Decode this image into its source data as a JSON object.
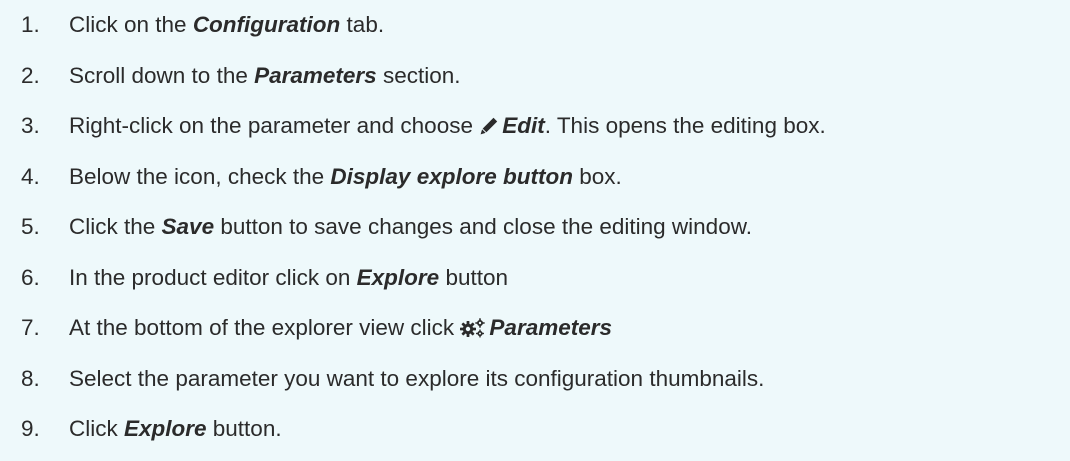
{
  "steps": [
    {
      "number": "1.",
      "parts": [
        {
          "t": "Click on the "
        },
        {
          "t": "Configuration",
          "em": true
        },
        {
          "t": " tab."
        }
      ]
    },
    {
      "number": "2.",
      "parts": [
        {
          "t": "Scroll down to the "
        },
        {
          "t": "Parameters",
          "em": true
        },
        {
          "t": " section."
        }
      ]
    },
    {
      "number": "3.",
      "parts": [
        {
          "t": "Right-click on the parameter and choose "
        },
        {
          "icon": "pencil-icon"
        },
        {
          "t": "Edit",
          "em": true
        },
        {
          "t": ". This opens the editing box."
        }
      ]
    },
    {
      "number": "4.",
      "parts": [
        {
          "t": "Below the icon, check the "
        },
        {
          "t": "Display explore button",
          "em": true
        },
        {
          "t": " box."
        }
      ]
    },
    {
      "number": "5.",
      "parts": [
        {
          "t": "Click the "
        },
        {
          "t": "Save",
          "em": true
        },
        {
          "t": " button to save changes and close the editing window."
        }
      ]
    },
    {
      "number": "6.",
      "parts": [
        {
          "t": "In the product editor click on "
        },
        {
          "t": "Explore",
          "em": true
        },
        {
          "t": " button"
        }
      ]
    },
    {
      "number": "7.",
      "parts": [
        {
          "t": "At the bottom of the explorer view click "
        },
        {
          "icon": "gears-icon"
        },
        {
          "t": "Parameters",
          "em": true
        }
      ]
    },
    {
      "number": "8.",
      "parts": [
        {
          "t": "Select the parameter you want to explore its configuration thumbnails."
        }
      ]
    },
    {
      "number": "9.",
      "parts": [
        {
          "t": "Click "
        },
        {
          "t": "Explore",
          "em": true
        },
        {
          "t": " button."
        }
      ]
    }
  ]
}
